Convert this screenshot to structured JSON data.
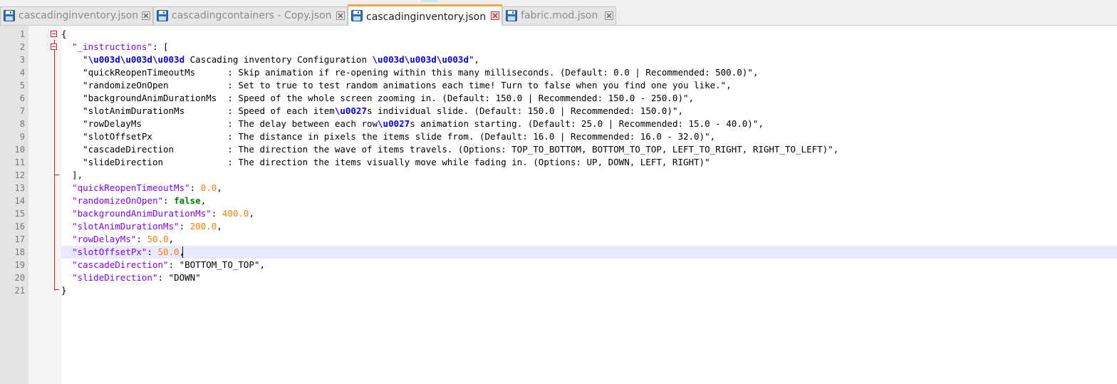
{
  "tabs": [
    {
      "label": "cascadinginventory.json",
      "active": false
    },
    {
      "label": "cascadingcontainers - Copy.json",
      "active": false
    },
    {
      "label": "cascadinginventory.json",
      "active": true
    },
    {
      "label": "fabric.mod.json",
      "active": false
    }
  ],
  "editor": {
    "line_numbers": [
      "1",
      "2",
      "3",
      "4",
      "5",
      "6",
      "7",
      "8",
      "9",
      "10",
      "11",
      "12",
      "13",
      "14",
      "15",
      "16",
      "17",
      "18",
      "19",
      "20",
      "21"
    ],
    "current_line": 18,
    "lines": [
      [
        {
          "t": "{",
          "c": "p"
        }
      ],
      [
        {
          "t": "  ",
          "c": "p"
        },
        {
          "t": "\"_instructions\"",
          "c": "str"
        },
        {
          "t": ": [",
          "c": "p"
        }
      ],
      [
        {
          "t": "    ",
          "c": "p"
        },
        {
          "t": "\"",
          "c": "strv"
        },
        {
          "t": "\\u003d\\u003d\\u003d",
          "c": "esc"
        },
        {
          "t": " Cascading inventory Configuration ",
          "c": "strv"
        },
        {
          "t": "\\u003d\\u003d\\u003d",
          "c": "esc"
        },
        {
          "t": "\"",
          "c": "strv"
        },
        {
          "t": ",",
          "c": "p"
        }
      ],
      [
        {
          "t": "    ",
          "c": "p"
        },
        {
          "t": "\"quickReopenTimeoutMs      : Skip animation if re-opening within this many milliseconds. (Default: 0.0 | Recommended: 500.0)\"",
          "c": "strv"
        },
        {
          "t": ",",
          "c": "p"
        }
      ],
      [
        {
          "t": "    ",
          "c": "p"
        },
        {
          "t": "\"randomizeOnOpen           : Set to true to test random animations each time! Turn to false when you find one you like.\"",
          "c": "strv"
        },
        {
          "t": ",",
          "c": "p"
        }
      ],
      [
        {
          "t": "    ",
          "c": "p"
        },
        {
          "t": "\"backgroundAnimDurationMs  : Speed of the whole screen zooming in. (Default: 150.0 | Recommended: 150.0 - 250.0)\"",
          "c": "strv"
        },
        {
          "t": ",",
          "c": "p"
        }
      ],
      [
        {
          "t": "    ",
          "c": "p"
        },
        {
          "t": "\"slotAnimDurationMs        : Speed of each item",
          "c": "strv"
        },
        {
          "t": "\\u0027",
          "c": "esc"
        },
        {
          "t": "s individual slide. (Default: 150.0 | Recommended: 150.0)\"",
          "c": "strv"
        },
        {
          "t": ",",
          "c": "p"
        }
      ],
      [
        {
          "t": "    ",
          "c": "p"
        },
        {
          "t": "\"rowDelayMs                : The delay between each row",
          "c": "strv"
        },
        {
          "t": "\\u0027",
          "c": "esc"
        },
        {
          "t": "s animation starting. (Default: 25.0 | Recommended: 15.0 - 40.0)\"",
          "c": "strv"
        },
        {
          "t": ",",
          "c": "p"
        }
      ],
      [
        {
          "t": "    ",
          "c": "p"
        },
        {
          "t": "\"slotOffsetPx              : The distance in pixels the items slide from. (Default: 16.0 | Recommended: 16.0 - 32.0)\"",
          "c": "strv"
        },
        {
          "t": ",",
          "c": "p"
        }
      ],
      [
        {
          "t": "    ",
          "c": "p"
        },
        {
          "t": "\"cascadeDirection          : The direction the wave of items travels. (Options: TOP_TO_BOTTOM, BOTTOM_TO_TOP, LEFT_TO_RIGHT, RIGHT_TO_LEFT)\"",
          "c": "strv"
        },
        {
          "t": ",",
          "c": "p"
        }
      ],
      [
        {
          "t": "    ",
          "c": "p"
        },
        {
          "t": "\"slideDirection            : The direction the items visually move while fading in. (Options: UP, DOWN, LEFT, RIGHT)\"",
          "c": "strv"
        }
      ],
      [
        {
          "t": "  ],",
          "c": "p"
        }
      ],
      [
        {
          "t": "  ",
          "c": "p"
        },
        {
          "t": "\"quickReopenTimeoutMs\"",
          "c": "str"
        },
        {
          "t": ": ",
          "c": "p"
        },
        {
          "t": "0.0",
          "c": "num"
        },
        {
          "t": ",",
          "c": "p"
        }
      ],
      [
        {
          "t": "  ",
          "c": "p"
        },
        {
          "t": "\"randomizeOnOpen\"",
          "c": "str"
        },
        {
          "t": ": ",
          "c": "p"
        },
        {
          "t": "false",
          "c": "kw"
        },
        {
          "t": ",",
          "c": "p"
        }
      ],
      [
        {
          "t": "  ",
          "c": "p"
        },
        {
          "t": "\"backgroundAnimDurationMs\"",
          "c": "str"
        },
        {
          "t": ": ",
          "c": "p"
        },
        {
          "t": "400.0",
          "c": "num"
        },
        {
          "t": ",",
          "c": "p"
        }
      ],
      [
        {
          "t": "  ",
          "c": "p"
        },
        {
          "t": "\"slotAnimDurationMs\"",
          "c": "str"
        },
        {
          "t": ": ",
          "c": "p"
        },
        {
          "t": "200.0",
          "c": "num"
        },
        {
          "t": ",",
          "c": "p"
        }
      ],
      [
        {
          "t": "  ",
          "c": "p"
        },
        {
          "t": "\"rowDelayMs\"",
          "c": "str"
        },
        {
          "t": ": ",
          "c": "p"
        },
        {
          "t": "50.0",
          "c": "num"
        },
        {
          "t": ",",
          "c": "p"
        }
      ],
      [
        {
          "t": "  ",
          "c": "p"
        },
        {
          "t": "\"slotOffsetPx\"",
          "c": "str"
        },
        {
          "t": ": ",
          "c": "p"
        },
        {
          "t": "50.0",
          "c": "num"
        },
        {
          "t": ",",
          "c": "p"
        }
      ],
      [
        {
          "t": "  ",
          "c": "p"
        },
        {
          "t": "\"cascadeDirection\"",
          "c": "str"
        },
        {
          "t": ": ",
          "c": "p"
        },
        {
          "t": "\"BOTTOM_TO_TOP\"",
          "c": "strv"
        },
        {
          "t": ",",
          "c": "p"
        }
      ],
      [
        {
          "t": "  ",
          "c": "p"
        },
        {
          "t": "\"slideDirection\"",
          "c": "str"
        },
        {
          "t": ": ",
          "c": "p"
        },
        {
          "t": "\"DOWN\"",
          "c": "strv"
        }
      ],
      [
        {
          "t": "}",
          "c": "p"
        }
      ]
    ]
  },
  "colors": {
    "active_tab_accent": "#f3a546",
    "fold_marker": "#e01e1e",
    "current_line_bg": "#e8e8ff",
    "property_name": "#8000ff",
    "number": "#ff8000",
    "keyword": "#008000",
    "escape": "#0000ff"
  },
  "icons": {
    "tab_file_icon": "save-icon",
    "tab_close_icon": "close-icon",
    "fold_icon": "fold-minus-icon"
  }
}
